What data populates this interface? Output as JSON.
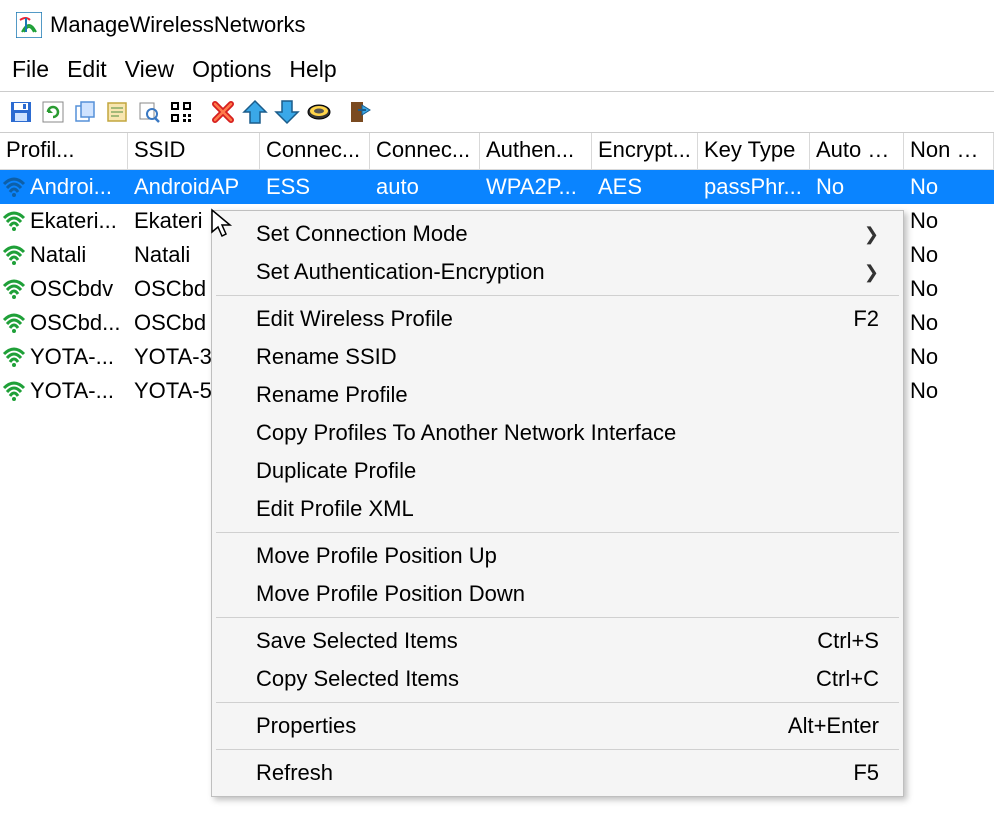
{
  "title": "ManageWirelessNetworks",
  "menu": {
    "file": "File",
    "edit": "Edit",
    "view": "View",
    "options": "Options",
    "help": "Help"
  },
  "toolbar": {
    "save": "save-icon",
    "refresh": "refresh-icon",
    "copy": "copy-icon",
    "props": "properties-icon",
    "find": "find-icon",
    "qr": "qr-icon",
    "delete": "delete-icon",
    "up": "arrow-up-icon",
    "down": "arrow-down-icon",
    "connect": "connect-icon",
    "exit": "exit-icon"
  },
  "columns": [
    "Profil...",
    "SSID",
    "Connec...",
    "Connec...",
    "Authen...",
    "Encrypt...",
    "Key Type",
    "Auto S...",
    "Non B..."
  ],
  "rows": [
    {
      "profile": "Androi...",
      "ssid": "AndroidAP",
      "ctype": "ESS",
      "cmode": "auto",
      "auth": "WPA2P...",
      "enc": "AES",
      "key": "passPhr...",
      "autos": "No",
      "nonb": "No",
      "selected": true
    },
    {
      "profile": "Ekateri...",
      "ssid": "Ekateri",
      "ctype": "",
      "cmode": "",
      "auth": "",
      "enc": "",
      "key": "",
      "autos": "",
      "nonb": "No",
      "selected": false
    },
    {
      "profile": "Natali",
      "ssid": "Natali",
      "ctype": "",
      "cmode": "",
      "auth": "",
      "enc": "",
      "key": "",
      "autos": "",
      "nonb": "No",
      "selected": false
    },
    {
      "profile": "OSCbdv",
      "ssid": "OSCbd",
      "ctype": "",
      "cmode": "",
      "auth": "",
      "enc": "",
      "key": "",
      "autos": "",
      "nonb": "No",
      "selected": false
    },
    {
      "profile": "OSCbd...",
      "ssid": "OSCbd",
      "ctype": "",
      "cmode": "",
      "auth": "",
      "enc": "",
      "key": "",
      "autos": "",
      "nonb": "No",
      "selected": false
    },
    {
      "profile": "YOTA-...",
      "ssid": "YOTA-3",
      "ctype": "",
      "cmode": "",
      "auth": "",
      "enc": "",
      "key": "",
      "autos": "",
      "nonb": "No",
      "selected": false
    },
    {
      "profile": "YOTA-...",
      "ssid": "YOTA-5",
      "ctype": "",
      "cmode": "",
      "auth": "",
      "enc": "",
      "key": "",
      "autos": "",
      "nonb": "No",
      "selected": false
    }
  ],
  "ctx": {
    "set_conn_mode": "Set Connection Mode",
    "set_auth_enc": "Set Authentication-Encryption",
    "edit_profile": "Edit Wireless Profile",
    "edit_profile_k": "F2",
    "rename_ssid": "Rename SSID",
    "rename_profile": "Rename Profile",
    "copy_profiles": "Copy Profiles To Another Network Interface",
    "duplicate": "Duplicate Profile",
    "edit_xml": "Edit Profile XML",
    "move_up": "Move Profile Position Up",
    "move_down": "Move Profile Position Down",
    "save_sel": "Save Selected Items",
    "save_sel_k": "Ctrl+S",
    "copy_sel": "Copy Selected Items",
    "copy_sel_k": "Ctrl+C",
    "properties": "Properties",
    "properties_k": "Alt+Enter",
    "refresh": "Refresh",
    "refresh_k": "F5"
  }
}
